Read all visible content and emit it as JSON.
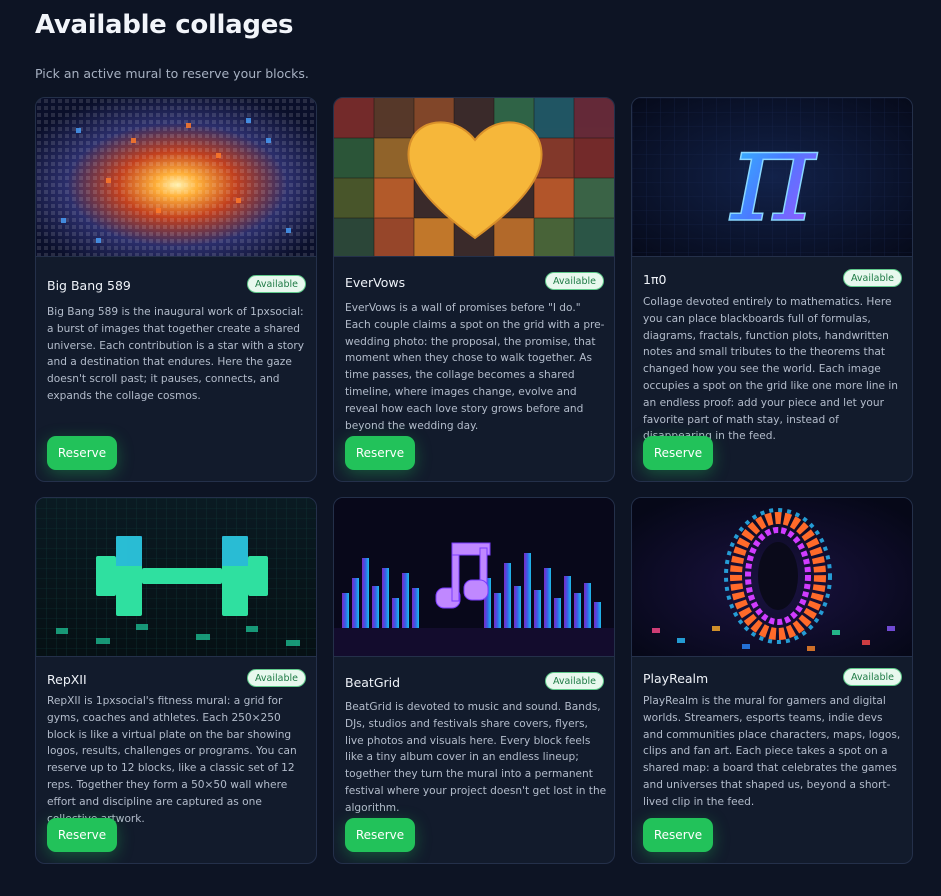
{
  "page": {
    "title": "Available collages",
    "subtitle": "Pick an active mural to reserve your blocks."
  },
  "cards": [
    {
      "title": "Big Bang 589",
      "status": "Available",
      "description": "Big Bang 589 is the inaugural work of 1pxsocial: a burst of images that together create a shared universe. Each contribution is a star with a story and a destination that endures. Here the gaze doesn't scroll past; it pauses, connects, and expands the collage cosmos.",
      "button": "Reserve",
      "image_icon": "starburst-image"
    },
    {
      "title": "EverVows",
      "status": "Available",
      "description": "EverVows is a wall of promises before \"I do.\" Each couple claims a spot on the grid with a pre-wedding photo: the proposal, the promise, that moment when they chose to walk together. As time passes, the collage becomes a shared timeline, where images change, evolve and reveal how each love story grows before and beyond the wedding day.",
      "button": "Reserve",
      "image_icon": "heart-image"
    },
    {
      "title": "1π0",
      "status": "Available",
      "description": "Collage devoted entirely to mathematics. Here you can place blackboards full of formulas, diagrams, fractals, function plots, handwritten notes and small tributes to the theorems that changed how you see the world. Each image occupies a spot on the grid like one more line in an endless proof: add your piece and let your favorite part of math stay, instead of disappearing in the feed.",
      "button": "Reserve",
      "image_icon": "pi-image"
    },
    {
      "title": "RepXII",
      "status": "Available",
      "description": "RepXII is 1pxsocial's fitness mural: a grid for gyms, coaches and athletes. Each 250×250 block is like a virtual plate on the bar showing logos, results, challenges or programs. You can reserve up to 12 blocks, like a classic set of 12 reps. Together they form a 50×50 wall where effort and discipline are captured as one collective artwork.",
      "button": "Reserve",
      "image_icon": "dumbbell-image"
    },
    {
      "title": "BeatGrid",
      "status": "Available",
      "description": "BeatGrid is devoted to music and sound. Bands, DJs, studios and festivals share covers, flyers, live photos and visuals here. Every block feels like a tiny album cover in an endless lineup; together they turn the mural into a permanent festival where your project doesn't get lost in the algorithm.",
      "button": "Reserve",
      "image_icon": "music-note-image"
    },
    {
      "title": "PlayRealm",
      "status": "Available",
      "description": "PlayRealm is the mural for gamers and digital worlds. Streamers, esports teams, indie devs and communities place characters, maps, logos, clips and fan art. Each piece takes a spot on a shared map: a board that celebrates the games and universes that shaped us, beyond a short-lived clip in the feed.",
      "button": "Reserve",
      "image_icon": "portal-ring-image"
    }
  ],
  "colors": {
    "background": "#0d1424",
    "card": "#121b2c",
    "accent_button": "#22c25a",
    "badge_bg": "#e8f8ee",
    "badge_text": "#1d7a44"
  }
}
